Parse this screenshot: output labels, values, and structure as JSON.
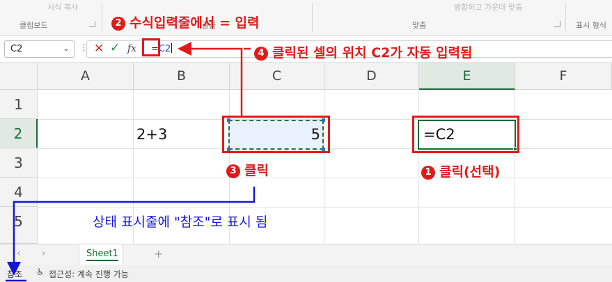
{
  "ribbon": {
    "faded_top": "서식 복사",
    "group_clipboard": "클립보드",
    "group_font": "글꼴",
    "group_alignment": "맞춤",
    "group_number": "표시 형식",
    "faded_align": "병합하고 가운데 맞춤"
  },
  "formula_bar": {
    "name_box_value": "C2",
    "cancel_icon": "✕",
    "enter_icon": "✓",
    "fx_label": "fx",
    "formula_eq": "=",
    "formula_ref": "C2"
  },
  "grid": {
    "columns": [
      "A",
      "B",
      "C",
      "D",
      "E",
      "F"
    ],
    "rows": [
      "1",
      "2",
      "3",
      "4",
      "5"
    ],
    "cells": {
      "B2": "2+3",
      "C2": "5",
      "E2": "=C2"
    }
  },
  "sheet_tabs": {
    "prev_icon": "‹",
    "next_icon": "›",
    "active_sheet": "Sheet1",
    "add_icon": "+"
  },
  "status_bar": {
    "mode": "참조",
    "accessibility": "접근성: 계속 진행 가능"
  },
  "annotations": {
    "step1_num": "1",
    "step1": "클릭(선택)",
    "step2_num": "2",
    "step2": "수식입력줄에서  = 입력",
    "step3_num": "3",
    "step3": "클릭",
    "step4_num": "4",
    "step4": "클릭된 셀의 위치 C2가 자동 입력됨",
    "status_note": "상태 표시줄에 \"참조\"로 표시 됨"
  },
  "colors": {
    "excel_green": "#1d6b37",
    "annotation_red": "#e11a1a",
    "annotation_blue": "#1515d8",
    "reference_blue": "#2e4fc7"
  },
  "icons": {
    "cancel": "close-icon",
    "enter": "check-icon",
    "function": "fx-icon",
    "accessibility": "accessibility-icon"
  }
}
